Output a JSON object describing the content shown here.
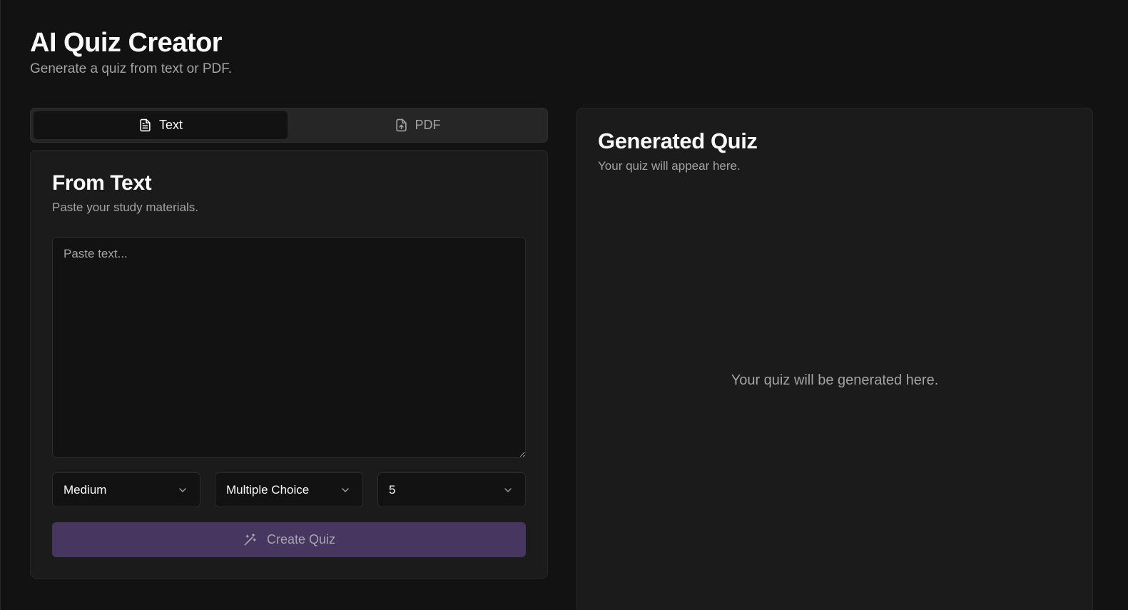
{
  "header": {
    "title": "AI Quiz Creator",
    "subtitle": "Generate a quiz from text or PDF."
  },
  "tabs": [
    {
      "label": "Text",
      "icon": "file-text-icon",
      "active": true
    },
    {
      "label": "PDF",
      "icon": "file-upload-icon",
      "active": false
    }
  ],
  "source_card": {
    "title": "From Text",
    "description": "Paste your study materials.",
    "textarea": {
      "placeholder": "Paste text...",
      "value": ""
    },
    "difficulty": {
      "value": "Medium"
    },
    "question_type": {
      "value": "Multiple Choice"
    },
    "question_count": {
      "value": "5"
    },
    "create_button": {
      "label": "Create Quiz",
      "icon": "magic-wand-icon",
      "disabled": true
    }
  },
  "result_card": {
    "title": "Generated Quiz",
    "description": "Your quiz will appear here.",
    "empty_message": "Your quiz will be generated here."
  },
  "colors": {
    "background": "#121212",
    "card": "#1b1b1b",
    "accent_button": "#47365f",
    "muted_text": "#a3a3a3"
  }
}
